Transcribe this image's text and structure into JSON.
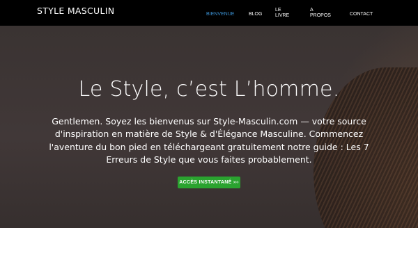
{
  "brand": "STYLE MASCULIN",
  "nav": {
    "items": [
      {
        "label": "BIENVENUE",
        "active": true
      },
      {
        "label": "BLOG"
      },
      {
        "label": "LE LIVRE"
      },
      {
        "label": "A PROPOS"
      },
      {
        "label": "CONTACT"
      }
    ]
  },
  "hero": {
    "title": "Le Style, c’est L’homme.",
    "text": "Gentlemen. Soyez les bienvenus sur Style-Masculin.com — votre source d'inspiration en matière de Style & d'Élégance Masculine. Commencez l'aventure du bon pied en téléchargeant gratuitement notre guide : Les 7 Erreurs de Style que vous faites probablement.",
    "cta_label": "ACCÈS INSTANTANÉ ›››"
  },
  "colors": {
    "navbar": "#000000",
    "active_nav": "#3a8fd0",
    "cta": "#2aa32f",
    "hero_overlay": "#3a3332"
  }
}
